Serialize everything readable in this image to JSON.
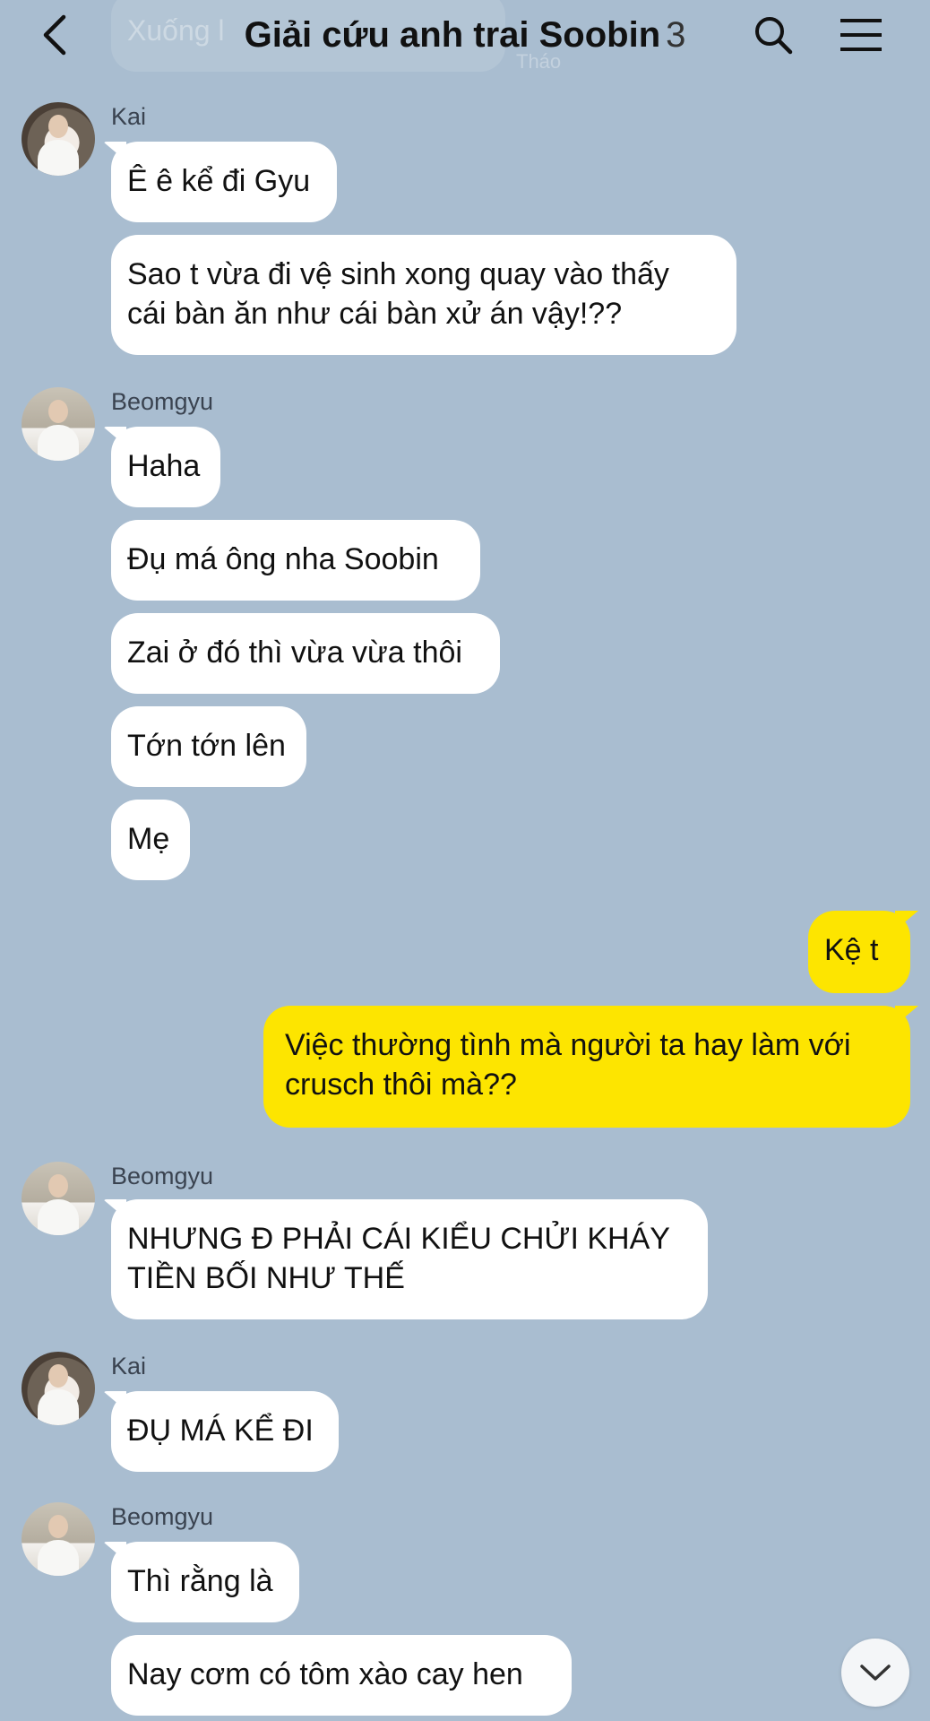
{
  "header": {
    "title": "Giải cứu anh trai Soobin",
    "member_count": "3",
    "back_icon": "chevron-left-icon",
    "search_icon": "search-icon",
    "menu_icon": "hamburger-menu-icon"
  },
  "previous_message": {
    "text": "Xuống l",
    "time": "Tháo"
  },
  "messages": [
    {
      "sender": "Kai",
      "bubbles": [
        "Ê ê kể đi Gyu",
        "Sao t vừa đi vệ sinh xong quay vào thấy\ncái bàn ăn như cái bàn xử án vậy!??"
      ]
    },
    {
      "sender": "Beomgyu",
      "bubbles": [
        "Haha",
        "Đụ má ông nha Soobin",
        "Zai ở đó thì vừa vừa thôi",
        "Tớn tớn lên",
        "Mẹ"
      ]
    },
    {
      "sender": "me",
      "bubbles": [
        "Kệ t",
        "Việc thường tình mà người ta hay làm với\ncrusch thôi mà??"
      ]
    },
    {
      "sender": "Beomgyu",
      "bubbles": [
        "NHƯNG Đ PHẢI CÁI KIỂU CHỬI KHÁY\nTIỀN BỐI NHƯ THẾ"
      ]
    },
    {
      "sender": "Kai",
      "bubbles": [
        "ĐỤ MÁ KỂ ĐI"
      ]
    },
    {
      "sender": "Beomgyu",
      "bubbles": [
        "Thì rằng là",
        "Nay cơm có tôm xào cay hen"
      ]
    }
  ],
  "scroll_down_icon": "chevron-down-icon",
  "colors": {
    "background": "#a9bdd0",
    "incoming_bubble": "#ffffff",
    "outgoing_bubble": "#fde500"
  }
}
